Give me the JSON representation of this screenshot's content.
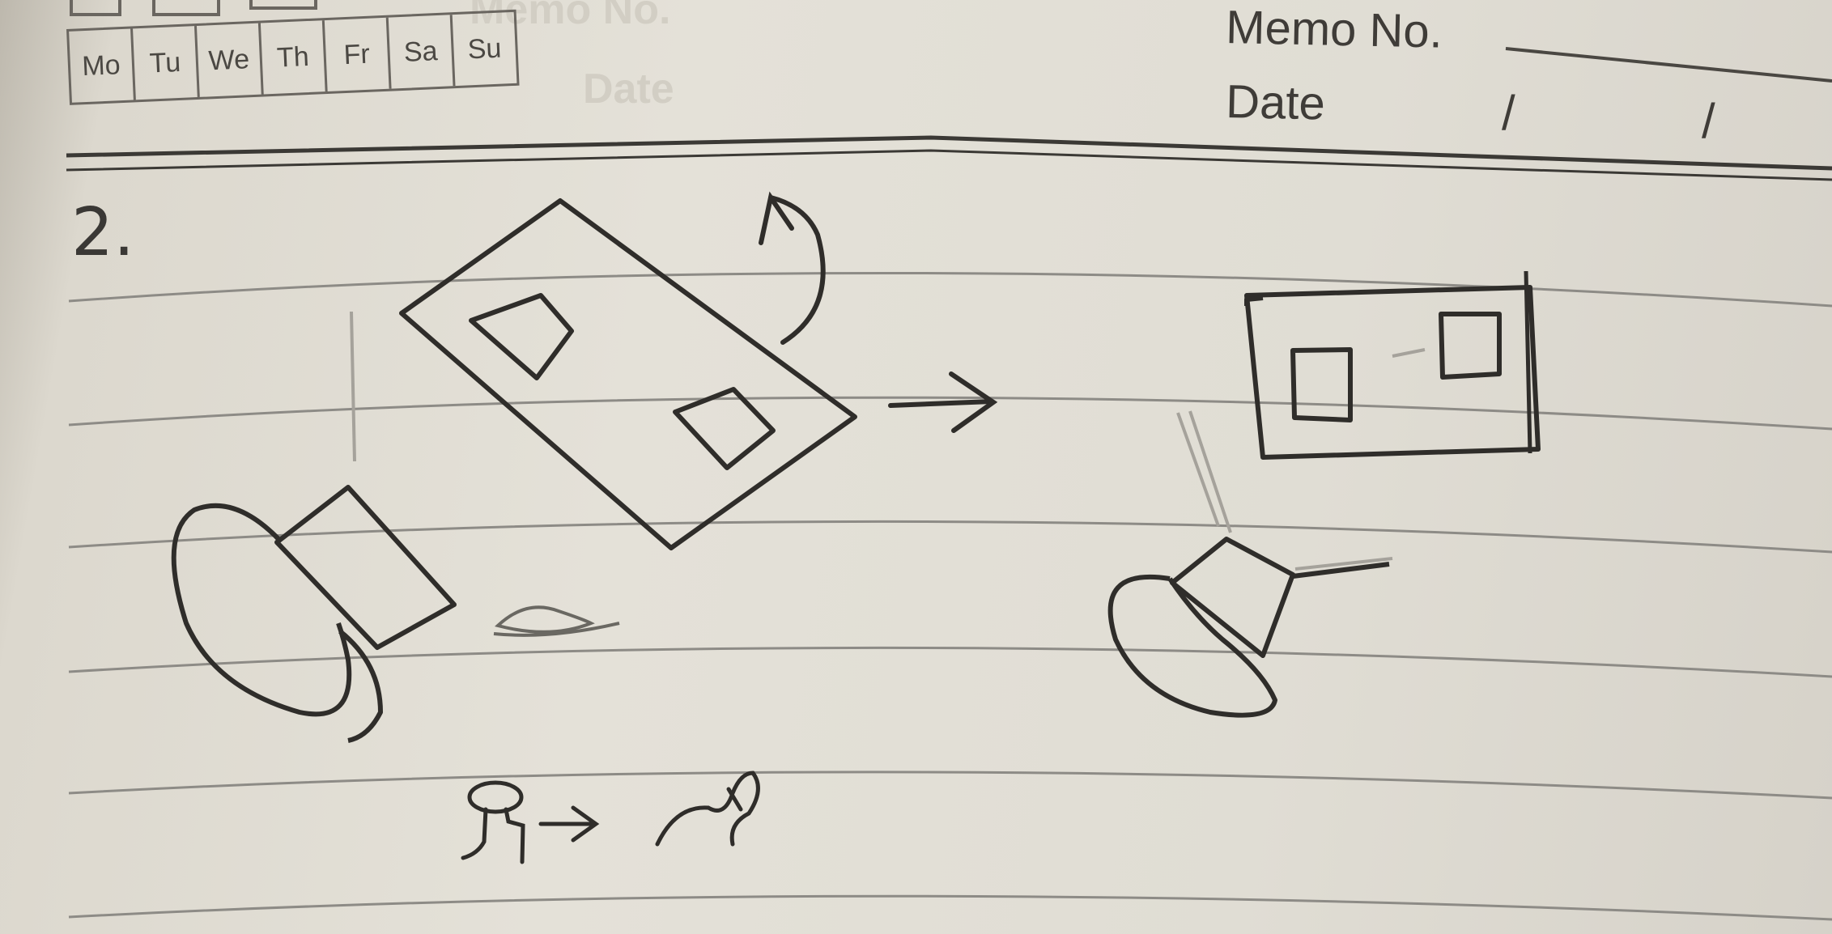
{
  "header": {
    "weekdays": [
      "Mo",
      "Tu",
      "We",
      "Th",
      "Fr",
      "Sa",
      "Su"
    ],
    "memo_label": "Memo No.",
    "date_label": "Date",
    "date_separator": "/",
    "ghost_text": [
      "Memo No.",
      "Date"
    ]
  },
  "content": {
    "item_number": "2."
  },
  "colors": {
    "paper": "#e2ded5",
    "ink": "#3a3835",
    "rule": "#8d8b86"
  }
}
